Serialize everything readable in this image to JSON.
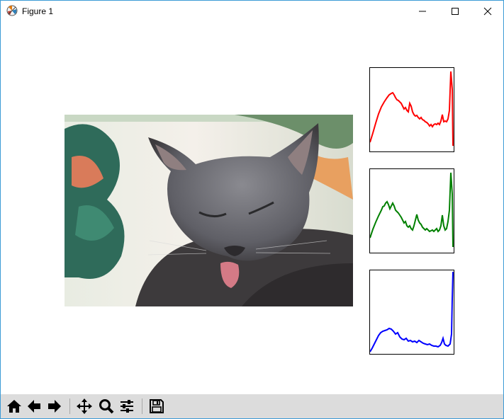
{
  "window": {
    "title": "Figure 1"
  },
  "controls": {
    "minimize": "minimize",
    "maximize": "maximize",
    "close": "close"
  },
  "figure": {
    "image": {
      "subject": "cat",
      "colors": {
        "fur": "#6b6b70",
        "tongue": "#d47a86",
        "leaf": "#2f6b5a"
      }
    },
    "histograms": [
      {
        "channel": "red",
        "color": "#ff0000"
      },
      {
        "channel": "green",
        "color": "#008000"
      },
      {
        "channel": "blue",
        "color": "#0000ff"
      }
    ]
  },
  "toolbar": {
    "buttons": [
      "home-icon",
      "back-icon",
      "forward-icon",
      "pan-icon",
      "zoom-icon",
      "configure-subplots-icon",
      "save-icon"
    ]
  }
}
